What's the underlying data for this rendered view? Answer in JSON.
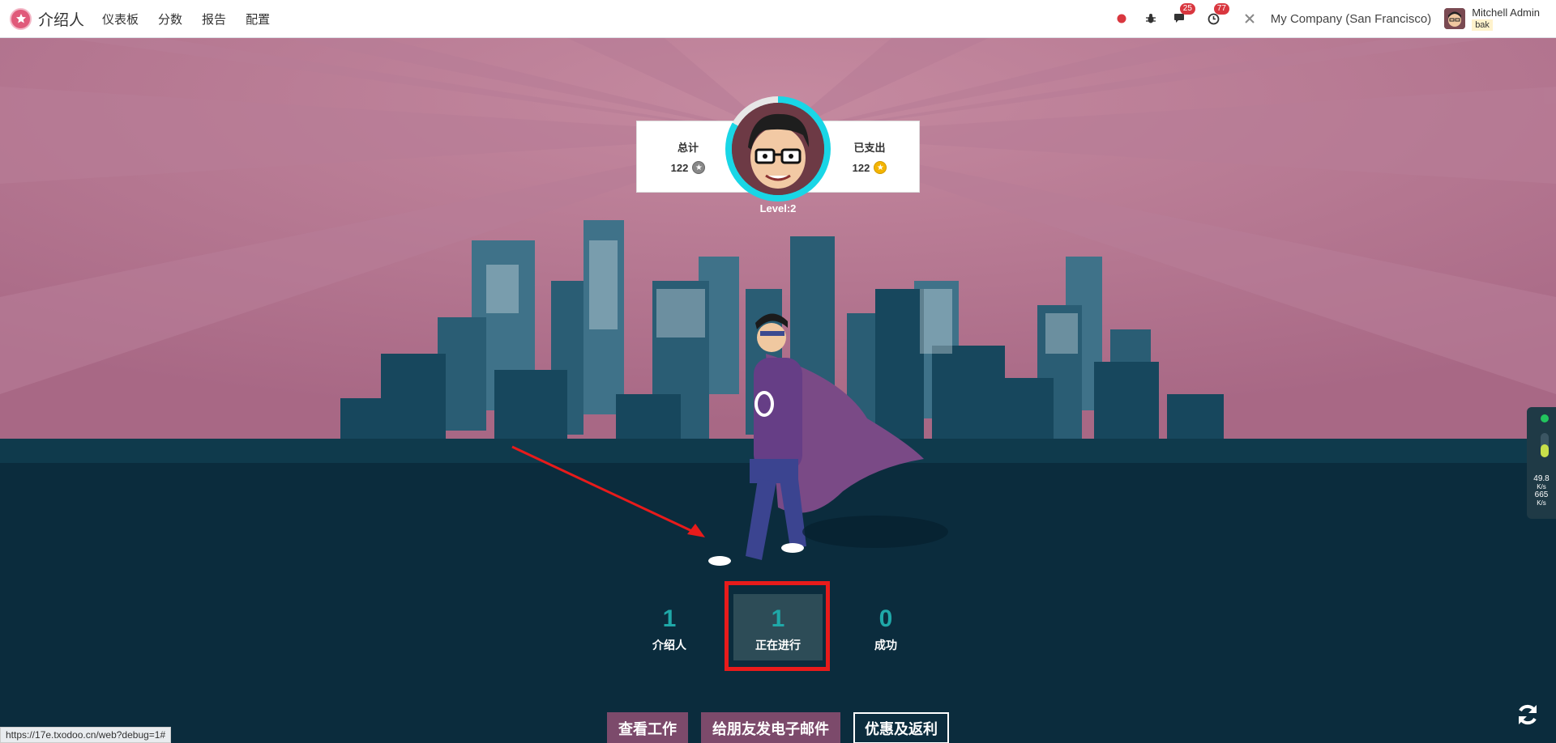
{
  "navbar": {
    "app_name": "介绍人",
    "menu": [
      "仪表板",
      "分数",
      "报告",
      "配置"
    ],
    "messages_badge": "25",
    "activities_badge": "77",
    "company": "My Company (San Francisco)",
    "user_name": "Mitchell Admin",
    "user_db": "bak"
  },
  "stats": {
    "total_label": "总计",
    "total_value": "122",
    "spent_label": "已支出",
    "spent_value": "122",
    "level": "Level:2"
  },
  "counters": [
    {
      "num": "1",
      "label": "介绍人"
    },
    {
      "num": "1",
      "label": "正在进行"
    },
    {
      "num": "0",
      "label": "成功"
    }
  ],
  "buttons": {
    "view_jobs": "查看工作",
    "email_friends": "给朋友发电子邮件",
    "rewards": "优惠及返利"
  },
  "network_widget": {
    "up_value": "49.8",
    "up_unit": "K/s",
    "down_value": "665",
    "down_unit": "K/s"
  },
  "status_url": "https://17e.txodoo.cn/web?debug=1#",
  "colors": {
    "accent": "#7c4a6b",
    "teal": "#1fa8a8",
    "sky": "#b67790",
    "ground": "#0b2c3d",
    "highlight": "#e81b1b"
  }
}
